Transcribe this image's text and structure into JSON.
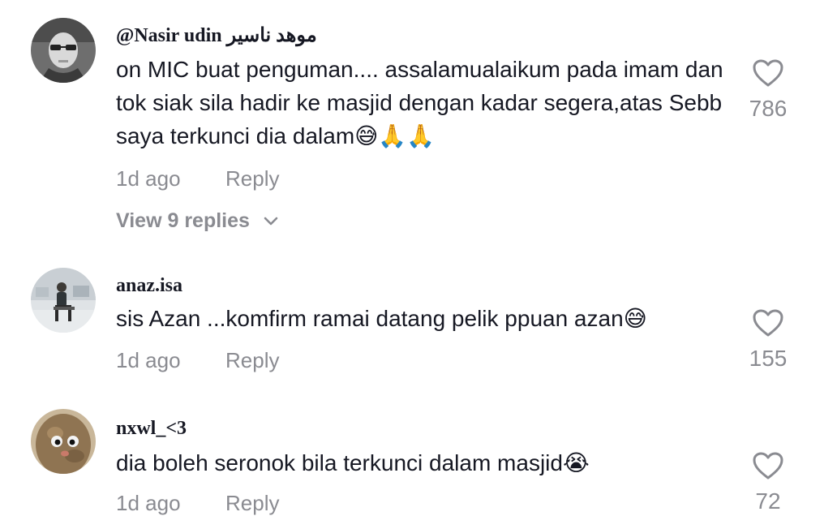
{
  "comments": [
    {
      "username": "@Nasir udin موهد ناسير",
      "text": "on MIC buat penguman.... assalamualaikum pada imam dan tok siak sila hadir ke masjid dengan kadar segera,atas Sebb saya terkunci dia dalam😅🙏🙏",
      "time": "1d ago",
      "reply_label": "Reply",
      "view_replies": "View 9 replies",
      "likes": "786",
      "avatar": "grayscale-face-avatar"
    },
    {
      "username": "anaz.isa",
      "text": "sis Azan ...komfirm ramai datang pelik ppuan azan😅",
      "time": "1d ago",
      "reply_label": "Reply",
      "likes": "155",
      "avatar": "person-sitting-avatar"
    },
    {
      "username": "nxwl_<3",
      "text": "dia boleh seronok bila terkunci dalam masjid😭",
      "time": "1d ago",
      "reply_label": "Reply",
      "likes": "72",
      "avatar": "potato-character-avatar"
    }
  ],
  "colors": {
    "primary_text": "#161823",
    "secondary_text": "#8a8b91",
    "icon_stroke": "#8a8b91"
  }
}
